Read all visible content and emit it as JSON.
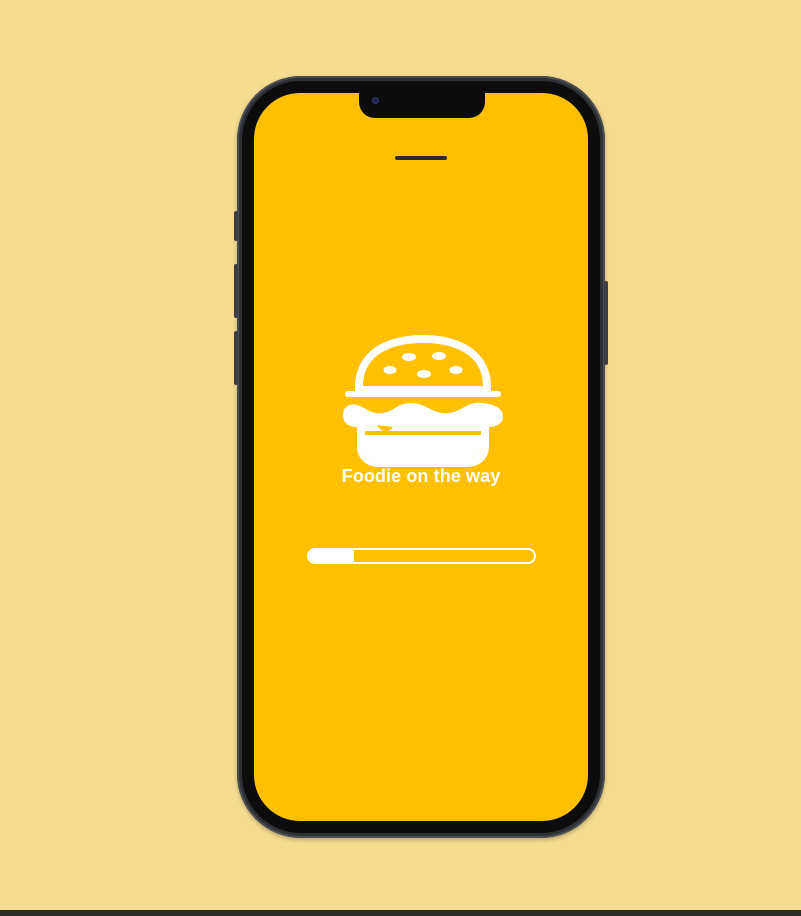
{
  "splash": {
    "tagline": "Foodie on the way",
    "logo_icon": "burger-icon",
    "progress_fraction": 0.2
  },
  "colors": {
    "page_background": "#f6dc91",
    "screen_background": "#ffc001",
    "foreground": "#ffffff",
    "phone_frame": "#2d3034"
  }
}
